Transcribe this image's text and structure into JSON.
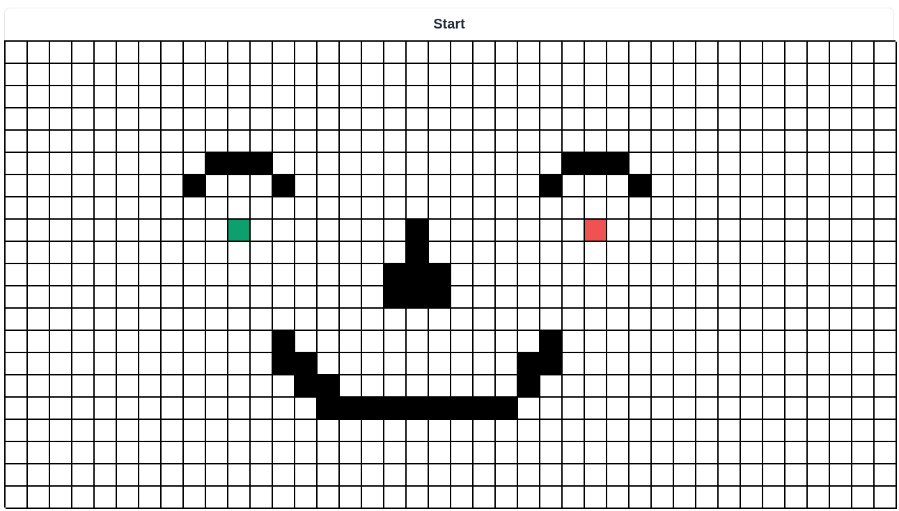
{
  "toolbar": {
    "start_label": "Start"
  },
  "grid": {
    "columns": 40,
    "rows": 21,
    "wall_color": "#000000",
    "empty_color": "#ffffff",
    "start_color": "#0e9f6e",
    "end_color": "#f05252",
    "start_cell": {
      "row": 8,
      "col": 10
    },
    "end_cell": {
      "row": 8,
      "col": 26
    },
    "walls": [
      [
        5,
        9
      ],
      [
        5,
        10
      ],
      [
        5,
        11
      ],
      [
        6,
        8
      ],
      [
        6,
        12
      ],
      [
        5,
        25
      ],
      [
        5,
        26
      ],
      [
        5,
        27
      ],
      [
        6,
        24
      ],
      [
        6,
        28
      ],
      [
        8,
        18
      ],
      [
        9,
        18
      ],
      [
        10,
        17
      ],
      [
        10,
        18
      ],
      [
        10,
        19
      ],
      [
        11,
        17
      ],
      [
        11,
        18
      ],
      [
        11,
        19
      ],
      [
        13,
        12
      ],
      [
        14,
        12
      ],
      [
        14,
        13
      ],
      [
        15,
        13
      ],
      [
        15,
        14
      ],
      [
        16,
        14
      ],
      [
        16,
        15
      ],
      [
        16,
        16
      ],
      [
        16,
        17
      ],
      [
        16,
        18
      ],
      [
        16,
        19
      ],
      [
        16,
        20
      ],
      [
        16,
        21
      ],
      [
        16,
        22
      ],
      [
        15,
        23
      ],
      [
        14,
        23
      ],
      [
        14,
        24
      ],
      [
        13,
        24
      ]
    ]
  }
}
